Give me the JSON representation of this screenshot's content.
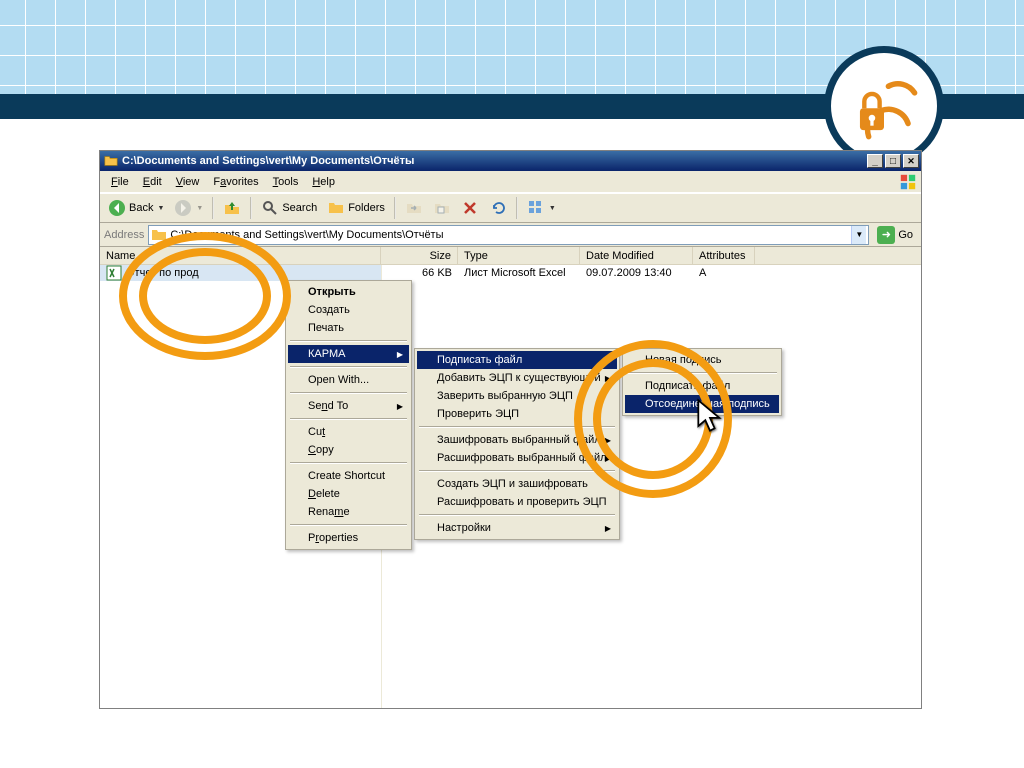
{
  "titlebar": {
    "path": "C:\\Documents and Settings\\vert\\My Documents\\Отчёты"
  },
  "titlebar_buttons": {
    "min": "_",
    "max": "□",
    "close": "✕"
  },
  "menu": {
    "file": "File",
    "edit": "Edit",
    "view": "View",
    "favorites": "Favorites",
    "tools": "Tools",
    "help": "Help"
  },
  "toolbar": {
    "back": "Back",
    "search": "Search",
    "folders": "Folders"
  },
  "address": {
    "label": "Address",
    "value": "C:\\Documents and Settings\\vert\\My Documents\\Отчёты",
    "go": "Go"
  },
  "columns": {
    "name": "Name",
    "size": "Size",
    "type": "Type",
    "modified": "Date Modified",
    "attrs": "Attributes"
  },
  "files": [
    {
      "name": "Отчет по прод",
      "size": "66 KB",
      "type": "Лист Microsoft Excel",
      "modified": "09.07.2009 13:40",
      "attrs": "A"
    }
  ],
  "ctx_main": {
    "open": "Открыть",
    "new": "Создать",
    "print": "Печать",
    "karma": "КАРМА",
    "open_with": "Open With...",
    "send_to": "Send To",
    "cut": "Cut",
    "copy": "Copy",
    "create_shortcut": "Create Shortcut",
    "delete": "Delete",
    "rename": "Rename",
    "properties": "Properties"
  },
  "ctx_karma": {
    "sign_file": "Подписать файл",
    "add_sig": "Добавить ЭЦП к существующей",
    "certify": "Заверить выбранную ЭЦП",
    "verify": "Проверить ЭЦП",
    "encrypt": "Зашифровать выбранный файл",
    "decrypt": "Расшифровать выбранный файл",
    "sign_encrypt": "Создать ЭЦП и зашифровать",
    "decrypt_verify": "Расшифровать и проверить ЭЦП",
    "settings": "Настройки"
  },
  "ctx_sign": {
    "new_sig": "Новая подпись",
    "sign_file2": "Подписать файл",
    "detached": "Отсоединенная подпись"
  }
}
